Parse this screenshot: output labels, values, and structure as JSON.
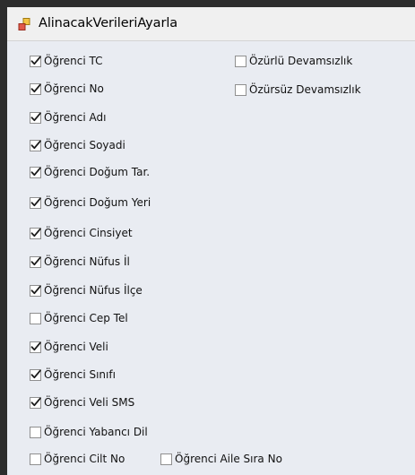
{
  "window": {
    "title": "AlinacakVerileriAyarla"
  },
  "checkboxes": [
    {
      "key": "tc",
      "label": "Öğrenci TC",
      "checked": true
    },
    {
      "key": "no",
      "label": "Öğrenci No",
      "checked": true
    },
    {
      "key": "adi",
      "label": "Öğrenci Adı",
      "checked": true
    },
    {
      "key": "soyadi",
      "label": "Öğrenci Soyadi",
      "checked": true
    },
    {
      "key": "dogum_tar",
      "label": "Öğrenci Doğum Tar.",
      "checked": true
    },
    {
      "key": "dogum_yeri",
      "label": "Öğrenci Doğum Yeri",
      "checked": true
    },
    {
      "key": "cinsiyet",
      "label": "Öğrenci Cinsiyet",
      "checked": true
    },
    {
      "key": "nufus_il",
      "label": "Öğrenci Nüfus İl",
      "checked": true
    },
    {
      "key": "nufus_ilce",
      "label": "Öğrenci Nüfus İlçe",
      "checked": true
    },
    {
      "key": "cep_tel",
      "label": "Öğrenci Cep Tel",
      "checked": false
    },
    {
      "key": "veli",
      "label": "Öğrenci Veli",
      "checked": true
    },
    {
      "key": "sinifi",
      "label": "Öğrenci Sınıfı",
      "checked": true
    },
    {
      "key": "veli_sms",
      "label": "Öğrenci Veli SMS",
      "checked": true
    },
    {
      "key": "yabanci_dil",
      "label": "Öğrenci Yabancı Dil",
      "checked": false
    },
    {
      "key": "cilt_no",
      "label": "Öğrenci Cilt No",
      "checked": false
    },
    {
      "key": "aile_sira_no",
      "label": "Öğrenci Aile Sıra No",
      "checked": false
    },
    {
      "key": "ozurlu",
      "label": "Özürlü Devamsızlık",
      "checked": false
    },
    {
      "key": "ozursuz",
      "label": "Özürsüz Devamsızlık",
      "checked": false
    }
  ]
}
